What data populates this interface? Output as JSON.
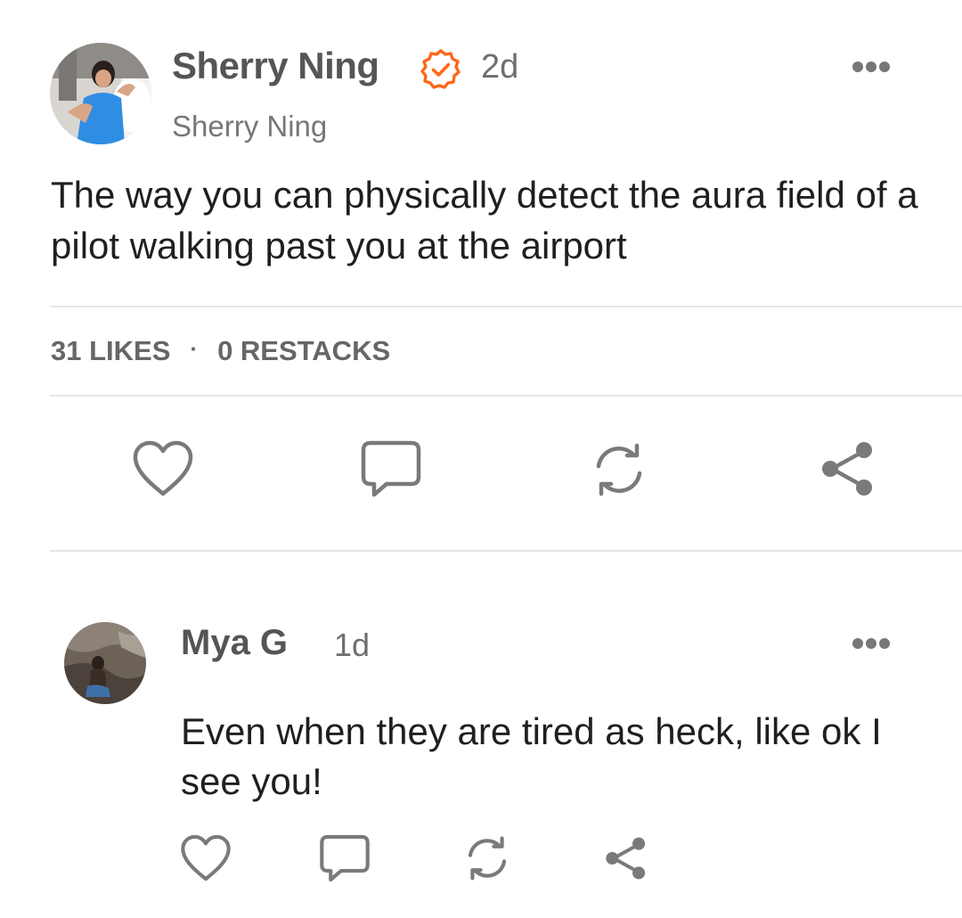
{
  "post": {
    "author_name": "Sherry Ning",
    "verified_icon": "verified-check-icon",
    "time": "2d",
    "handle": "Sherry Ning",
    "body": "The way you can physically detect the aura field of a pilot walking past you at the airport",
    "stats": {
      "likes": "31 LIKES",
      "separator": "·",
      "restacks": "0 RESTACKS"
    },
    "actions": [
      "heart-icon",
      "comment-icon",
      "restack-icon",
      "share-icon"
    ],
    "accent_color": "#ff6719"
  },
  "comment": {
    "author_name": "Mya G",
    "time": "1d",
    "body": "Even when they are tired as heck, like ok I see you!",
    "actions": [
      "heart-icon",
      "comment-icon",
      "restack-icon",
      "share-icon"
    ]
  }
}
